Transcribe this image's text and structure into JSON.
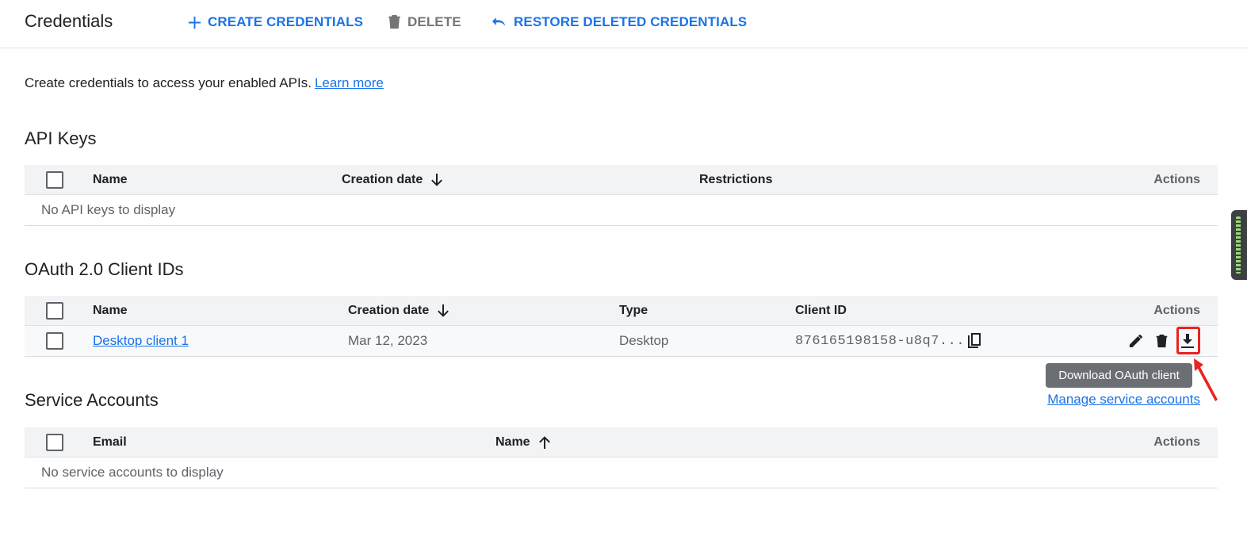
{
  "header": {
    "title": "Credentials",
    "create_label": "CREATE CREDENTIALS",
    "delete_label": "DELETE",
    "restore_label": "RESTORE DELETED CREDENTIALS"
  },
  "intro": {
    "text": "Create credentials to access your enabled APIs.",
    "learn_more": "Learn more"
  },
  "api_keys": {
    "title": "API Keys",
    "columns": {
      "name": "Name",
      "creation_date": "Creation date",
      "restrictions": "Restrictions",
      "actions": "Actions"
    },
    "empty": "No API keys to display"
  },
  "oauth": {
    "title": "OAuth 2.0 Client IDs",
    "columns": {
      "name": "Name",
      "creation_date": "Creation date",
      "type": "Type",
      "client_id": "Client ID",
      "actions": "Actions"
    },
    "rows": [
      {
        "name": "Desktop client 1",
        "creation_date": "Mar 12, 2023",
        "type": "Desktop",
        "client_id": "876165198158-u8q7..."
      }
    ],
    "tooltip": "Download OAuth client"
  },
  "service_accounts": {
    "title": "Service Accounts",
    "manage_link": "Manage service accounts",
    "columns": {
      "email": "Email",
      "name": "Name",
      "actions": "Actions"
    },
    "empty": "No service accounts to display"
  },
  "colors": {
    "accent": "#1a73e8",
    "highlight": "#e8241e",
    "header_bg": "#f1f3f4"
  }
}
